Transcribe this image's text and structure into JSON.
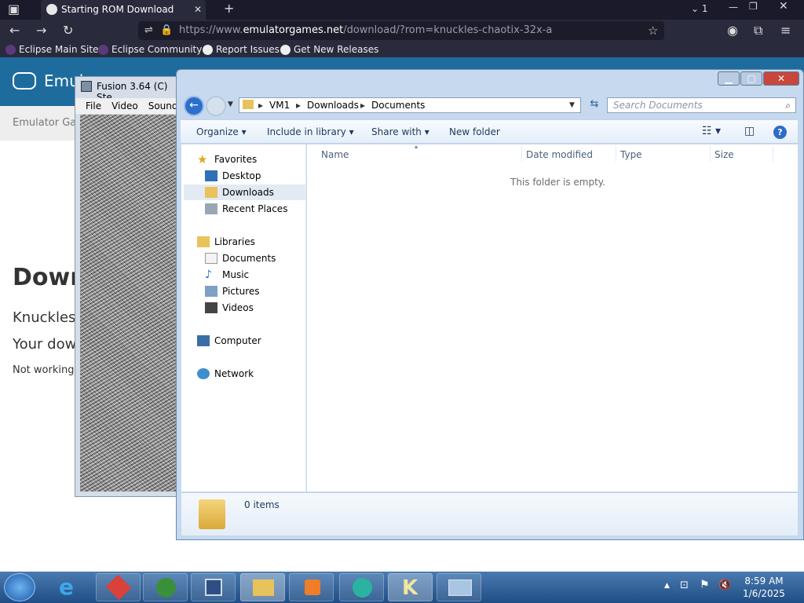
{
  "browser": {
    "tab_title": "Starting ROM Download Knuckl",
    "tab_count": "1",
    "url_prefix": "https://www.",
    "url_host": "emulatorgames.net",
    "url_path": "/download/?rom=knuckles-chaotix-32x-a",
    "bookmarks": [
      "Eclipse Main Site",
      "Eclipse Community",
      "Report Issues",
      "Get New Releases"
    ]
  },
  "webpage": {
    "brand": "Emul",
    "crumb": "Emulator Ga",
    "heading": "Down",
    "line1": "Knuckles",
    "line2": "Your dow",
    "line3": "Not working"
  },
  "fusion": {
    "title": "Fusion 3.64 (C) Ste",
    "menu": [
      "File",
      "Video",
      "Sound"
    ]
  },
  "explorer": {
    "breadcrumb": [
      "VM1",
      "Downloads",
      "Documents"
    ],
    "search_placeholder": "Search Documents",
    "toolbar": [
      "Organize ▾",
      "Include in library ▾",
      "Share with ▾",
      "New folder"
    ],
    "nav": {
      "favorites": "Favorites",
      "desktop": "Desktop",
      "downloads": "Downloads",
      "recent": "Recent Places",
      "libraries": "Libraries",
      "documents": "Documents",
      "music": "Music",
      "pictures": "Pictures",
      "videos": "Videos",
      "computer": "Computer",
      "network": "Network"
    },
    "columns": [
      "Name",
      "Date modified",
      "Type",
      "Size"
    ],
    "empty_message": "This folder is empty.",
    "item_count": "0 items"
  },
  "taskbar": {
    "time": "8:59 AM",
    "date": "1/6/2025"
  }
}
